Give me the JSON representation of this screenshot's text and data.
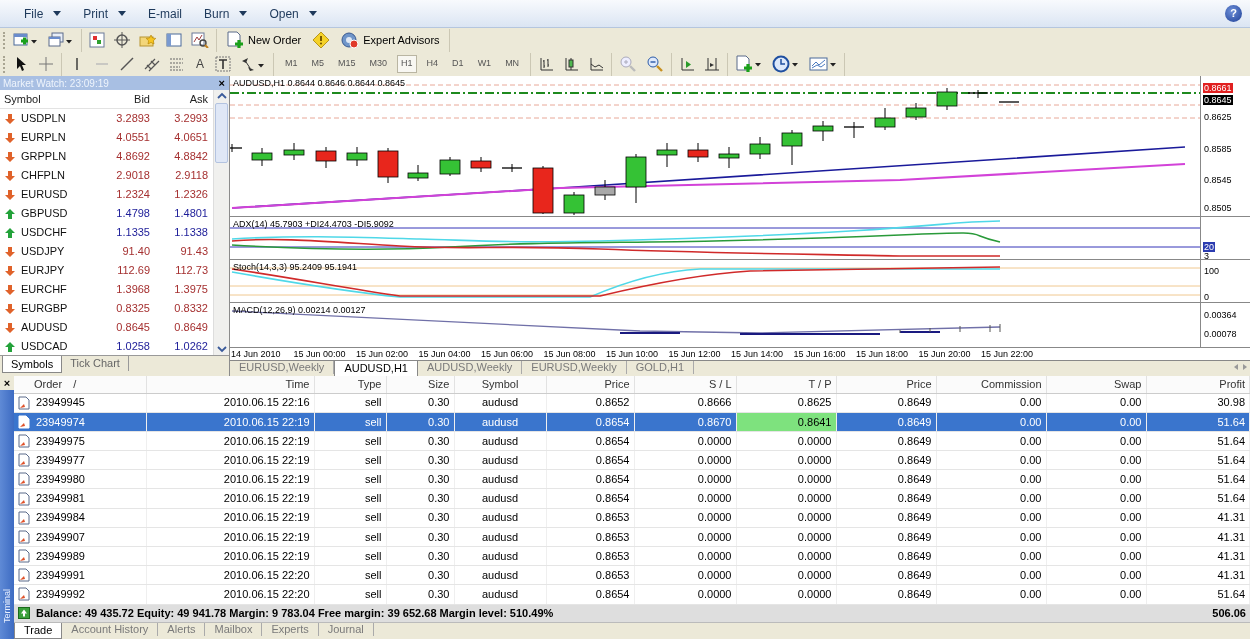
{
  "menu": [
    {
      "label": "File",
      "dropdown": true
    },
    {
      "label": "Print",
      "dropdown": true
    },
    {
      "label": "E-mail",
      "dropdown": false
    },
    {
      "label": "Burn",
      "dropdown": true
    },
    {
      "label": "Open",
      "dropdown": true
    }
  ],
  "help": "?",
  "toolbar": {
    "new_order": "New Order",
    "expert_advisors": "Expert Advisors",
    "text_tool": "A",
    "timeframes": [
      {
        "label": "M1",
        "selected": false
      },
      {
        "label": "M5",
        "selected": false
      },
      {
        "label": "M15",
        "selected": false
      },
      {
        "label": "M30",
        "selected": false
      },
      {
        "label": "H1",
        "selected": true
      },
      {
        "label": "H4",
        "selected": false
      },
      {
        "label": "D1",
        "selected": false
      },
      {
        "label": "W1",
        "selected": false
      },
      {
        "label": "MN",
        "selected": false
      }
    ]
  },
  "market_watch": {
    "title": "Market Watch: 23:09:19",
    "close": "×",
    "columns": [
      "Symbol",
      "Bid",
      "Ask"
    ],
    "rows": [
      {
        "symbol": "USDPLN",
        "bid": "3.2893",
        "ask": "3.2993",
        "rising": false
      },
      {
        "symbol": "EURPLN",
        "bid": "4.0551",
        "ask": "4.0651",
        "rising": false
      },
      {
        "symbol": "GRPPLN",
        "bid": "4.8692",
        "ask": "4.8842",
        "rising": false
      },
      {
        "symbol": "CHFPLN",
        "bid": "2.9018",
        "ask": "2.9118",
        "rising": false
      },
      {
        "symbol": "EURUSD",
        "bid": "1.2324",
        "ask": "1.2326",
        "rising": false
      },
      {
        "symbol": "GBPUSD",
        "bid": "1.4798",
        "ask": "1.4801",
        "rising": true
      },
      {
        "symbol": "USDCHF",
        "bid": "1.1335",
        "ask": "1.1338",
        "rising": true
      },
      {
        "symbol": "USDJPY",
        "bid": "91.40",
        "ask": "91.43",
        "rising": false
      },
      {
        "symbol": "EURJPY",
        "bid": "112.69",
        "ask": "112.73",
        "rising": false
      },
      {
        "symbol": "EURCHF",
        "bid": "1.3968",
        "ask": "1.3975",
        "rising": false
      },
      {
        "symbol": "EURGBP",
        "bid": "0.8325",
        "ask": "0.8332",
        "rising": false
      },
      {
        "symbol": "AUDUSD",
        "bid": "0.8645",
        "ask": "0.8649",
        "rising": false
      },
      {
        "symbol": "USDCAD",
        "bid": "1.0258",
        "ask": "1.0262",
        "rising": true
      }
    ],
    "tabs": [
      {
        "label": "Symbols",
        "selected": true
      },
      {
        "label": "Tick Chart",
        "selected": false
      }
    ]
  },
  "chart": {
    "title": "AUDUSD,H1  0.8644 0.8646 0.8644 0.8645",
    "price_labels": [
      {
        "label": "0.8661",
        "kind": "ask"
      },
      {
        "label": "0.8645",
        "kind": "bid"
      },
      {
        "label": "0.8625",
        "kind": "tick"
      },
      {
        "label": "0.8585",
        "kind": "tick"
      },
      {
        "label": "0.8545",
        "kind": "tick"
      },
      {
        "label": "0.8505",
        "kind": "tick"
      }
    ],
    "indicators": [
      {
        "title": "ADX(14) 45.7903 +DI24.4703 -DI5.9092",
        "kind": "adx",
        "axis_labels": [
          {
            "label": "20",
            "kind": "marker"
          },
          {
            "label": "3",
            "kind": "tick"
          }
        ]
      },
      {
        "title": "Stoch(14,3,3) 95.2409 95.1941",
        "kind": "stoch",
        "axis_labels": [
          {
            "label": "100",
            "kind": "tick"
          },
          {
            "label": "0",
            "kind": "tick"
          }
        ]
      },
      {
        "title": "MACD(12,26,9) 0.00214 0.00127",
        "kind": "macd",
        "axis_labels": [
          {
            "label": "0.00364",
            "kind": "tick"
          },
          {
            "label": "0.00078",
            "kind": "tick"
          }
        ]
      }
    ],
    "time_labels": [
      "14 Jun 2010",
      "15 Jun 00:00",
      "15 Jun 02:00",
      "15 Jun 04:00",
      "15 Jun 06:00",
      "15 Jun 08:00",
      "15 Jun 10:00",
      "15 Jun 12:00",
      "15 Jun 14:00",
      "15 Jun 16:00",
      "15 Jun 18:00",
      "15 Jun 20:00",
      "15 Jun 22:00"
    ]
  },
  "chart_tabs": [
    {
      "label": "EURUSD,Weekly",
      "selected": false
    },
    {
      "label": "AUDUSD,H1",
      "selected": true
    },
    {
      "label": "AUDUSD,Weekly",
      "selected": false
    },
    {
      "label": "EURUSD,Weekly",
      "selected": false
    },
    {
      "label": "GOLD,H1",
      "selected": false
    }
  ],
  "terminal": {
    "close": "×",
    "side_label": "Terminal",
    "columns": [
      {
        "label": "Order",
        "sort_mark": "/"
      },
      {
        "label": "Time"
      },
      {
        "label": "Type"
      },
      {
        "label": "Size"
      },
      {
        "label": "Symbol"
      },
      {
        "label": "Price"
      },
      {
        "label": "S / L"
      },
      {
        "label": "T / P"
      },
      {
        "label": "Price"
      },
      {
        "label": "Commission"
      },
      {
        "label": "Swap"
      },
      {
        "label": "Profit"
      }
    ],
    "rows": [
      {
        "order": "23949945",
        "time": "2010.06.15 22:16",
        "type": "sell",
        "size": "0.30",
        "symbol": "audusd",
        "price": "0.8652",
        "sl": "0.8666",
        "tp": "0.8625",
        "current": "0.8649",
        "commission": "0.00",
        "swap": "0.00",
        "profit": "30.98",
        "selected": false,
        "tp_highlight": false
      },
      {
        "order": "23949974",
        "time": "2010.06.15 22:19",
        "type": "sell",
        "size": "0.30",
        "symbol": "audusd",
        "price": "0.8654",
        "sl": "0.8670",
        "tp": "0.8641",
        "current": "0.8649",
        "commission": "0.00",
        "swap": "0.00",
        "profit": "51.64",
        "selected": true,
        "tp_highlight": true
      },
      {
        "order": "23949975",
        "time": "2010.06.15 22:19",
        "type": "sell",
        "size": "0.30",
        "symbol": "audusd",
        "price": "0.8654",
        "sl": "0.0000",
        "tp": "0.0000",
        "current": "0.8649",
        "commission": "0.00",
        "swap": "0.00",
        "profit": "51.64",
        "selected": false,
        "tp_highlight": false
      },
      {
        "order": "23949977",
        "time": "2010.06.15 22:19",
        "type": "sell",
        "size": "0.30",
        "symbol": "audusd",
        "price": "0.8654",
        "sl": "0.0000",
        "tp": "0.0000",
        "current": "0.8649",
        "commission": "0.00",
        "swap": "0.00",
        "profit": "51.64",
        "selected": false,
        "tp_highlight": false
      },
      {
        "order": "23949980",
        "time": "2010.06.15 22:19",
        "type": "sell",
        "size": "0.30",
        "symbol": "audusd",
        "price": "0.8654",
        "sl": "0.0000",
        "tp": "0.0000",
        "current": "0.8649",
        "commission": "0.00",
        "swap": "0.00",
        "profit": "51.64",
        "selected": false,
        "tp_highlight": false
      },
      {
        "order": "23949981",
        "time": "2010.06.15 22:19",
        "type": "sell",
        "size": "0.30",
        "symbol": "audusd",
        "price": "0.8654",
        "sl": "0.0000",
        "tp": "0.0000",
        "current": "0.8649",
        "commission": "0.00",
        "swap": "0.00",
        "profit": "51.64",
        "selected": false,
        "tp_highlight": false
      },
      {
        "order": "23949984",
        "time": "2010.06.15 22:19",
        "type": "sell",
        "size": "0.30",
        "symbol": "audusd",
        "price": "0.8653",
        "sl": "0.0000",
        "tp": "0.0000",
        "current": "0.8649",
        "commission": "0.00",
        "swap": "0.00",
        "profit": "41.31",
        "selected": false,
        "tp_highlight": false
      },
      {
        "order": "23949907",
        "time": "2010.06.15 22:19",
        "type": "sell",
        "size": "0.30",
        "symbol": "audusd",
        "price": "0.8653",
        "sl": "0.0000",
        "tp": "0.0000",
        "current": "0.8649",
        "commission": "0.00",
        "swap": "0.00",
        "profit": "41.31",
        "selected": false,
        "tp_highlight": false
      },
      {
        "order": "23949989",
        "time": "2010.06.15 22:19",
        "type": "sell",
        "size": "0.30",
        "symbol": "audusd",
        "price": "0.8653",
        "sl": "0.0000",
        "tp": "0.0000",
        "current": "0.8649",
        "commission": "0.00",
        "swap": "0.00",
        "profit": "41.31",
        "selected": false,
        "tp_highlight": false
      },
      {
        "order": "23949991",
        "time": "2010.06.15 22:20",
        "type": "sell",
        "size": "0.30",
        "symbol": "audusd",
        "price": "0.8653",
        "sl": "0.0000",
        "tp": "0.0000",
        "current": "0.8649",
        "commission": "0.00",
        "swap": "0.00",
        "profit": "41.31",
        "selected": false,
        "tp_highlight": false
      },
      {
        "order": "23949992",
        "time": "2010.06.15 22:20",
        "type": "sell",
        "size": "0.30",
        "symbol": "audusd",
        "price": "0.8654",
        "sl": "0.0000",
        "tp": "0.0000",
        "current": "0.8649",
        "commission": "0.00",
        "swap": "0.00",
        "profit": "51.64",
        "selected": false,
        "tp_highlight": false
      }
    ],
    "summary": "Balance: 49 435.72 Equity: 49 941.78 Margin: 9 783.04 Free margin: 39 652.68 Margin level: 510.49%",
    "total": "506.06",
    "tabs": [
      {
        "label": "Trade",
        "selected": true
      },
      {
        "label": "Account History",
        "selected": false
      },
      {
        "label": "Alerts",
        "selected": false
      },
      {
        "label": "Mailbox",
        "selected": false
      },
      {
        "label": "Experts",
        "selected": false
      },
      {
        "label": "Journal",
        "selected": false
      }
    ]
  }
}
